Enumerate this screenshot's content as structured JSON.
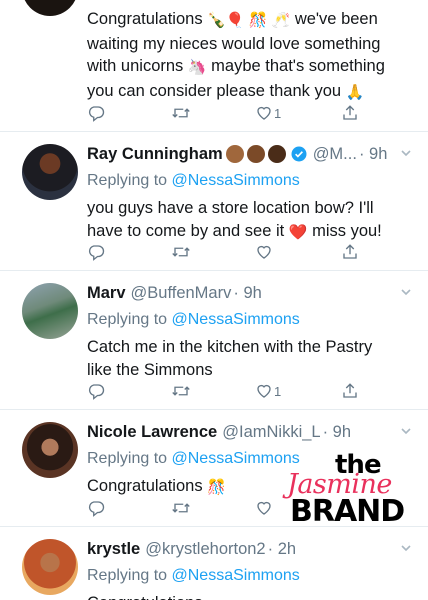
{
  "tweets": [
    {
      "body_text": "Congratulations 🍾🎈 🎊 🥂 we've been waiting my nieces would love something with unicorns 🦄 maybe that's something you can consider please thank you 🙏",
      "line1": "Congratulations",
      "line1_emoji": "🍾🎈 🎊 🥂",
      "line1_rest": "we've been",
      "line2": "waiting my nieces would love something",
      "line3a": "with unicorns",
      "line3_emoji": "🦄",
      "line3b": "maybe that's something",
      "line4": "you can consider please thank you",
      "line4_emoji": "🙏",
      "like_count": "1"
    },
    {
      "name": "Ray Cunningham",
      "handle": "@M...",
      "time": "· 9h",
      "replying_prefix": "Replying to",
      "replying_to": "@NessaSimmons",
      "line1": "you guys have a store location bow? I'll",
      "line2a": "have to come by and see it",
      "line2_emoji": "❤️",
      "line2b": "miss you!",
      "like_count": ""
    },
    {
      "name": "Marv",
      "handle": "@BuffenMarv",
      "time": "· 9h",
      "replying_prefix": "Replying to",
      "replying_to": "@NessaSimmons",
      "line1": "Catch me in the kitchen with the Pastry",
      "line2": "like the Simmons",
      "like_count": "1"
    },
    {
      "name": "Nicole Lawrence",
      "handle": "@IamNikki_L",
      "time": "· 9h",
      "replying_prefix": "Replying to",
      "replying_to": "@NessaSimmons",
      "line1": "Congratulations",
      "line1_emoji": "🎊",
      "like_count": ""
    },
    {
      "name": "krystle",
      "handle": "@krystlehorton2",
      "time": "· 2h",
      "replying_prefix": "Replying to",
      "replying_to": "@NessaSimmons",
      "line1": "Congratulations"
    }
  ],
  "watermark": {
    "the": "the",
    "jasmine": "Jasmine",
    "brand": "BRAND"
  },
  "icons": {
    "reply": "reply-icon",
    "retweet": "retweet-icon",
    "like": "like-icon",
    "share": "share-icon",
    "more": "chevron-down-icon",
    "verified": "verified-badge-icon"
  },
  "colors": {
    "link": "#1da1f2",
    "muted": "#657786",
    "text": "#14171a",
    "brand_pink": "#e9315c"
  }
}
